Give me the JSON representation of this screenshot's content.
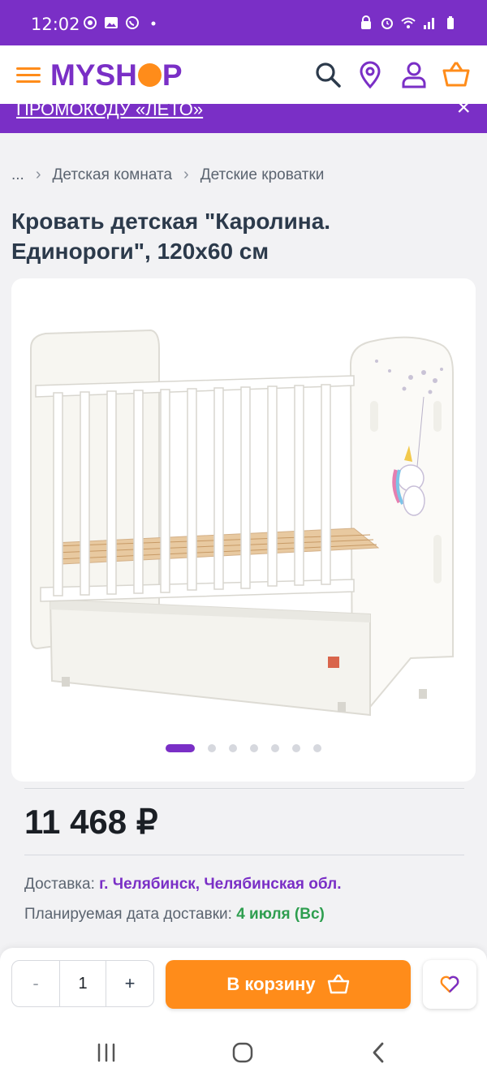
{
  "status_bar": {
    "time": "12:02"
  },
  "header": {
    "logo_left": "MYSH",
    "logo_right": "P"
  },
  "promo": {
    "text": "ПРОМОКОДУ «ЛЕТО»",
    "close": "×"
  },
  "breadcrumb": {
    "items": [
      "...",
      "Детская комната",
      "Детские кроватки"
    ]
  },
  "product": {
    "title": "Кровать детская \"Каролина. Единороги\", 120х60 см",
    "price": "11 468 ₽",
    "image_count": 7,
    "active_image": 1
  },
  "delivery": {
    "label": "Доставка: ",
    "city": "г. Челябинск, Челябинская обл.",
    "date_label": "Планируемая дата доставки: ",
    "date": "4 июля (Вс)"
  },
  "cart": {
    "minus": "-",
    "quantity": "1",
    "plus": "+",
    "add_label": "В корзину"
  },
  "colors": {
    "brand": "#7a2fc6",
    "accent": "#ff8c1a",
    "success": "#2e9e4f"
  }
}
